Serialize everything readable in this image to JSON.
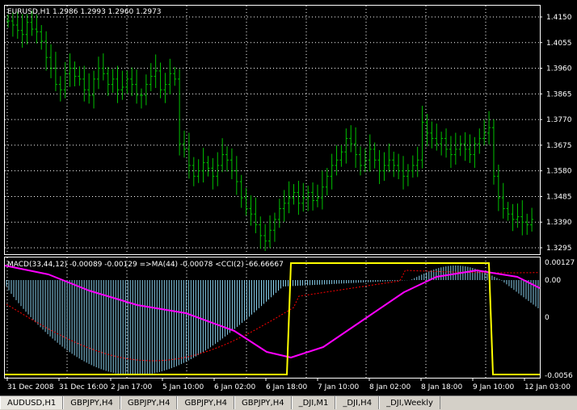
{
  "main_chart": {
    "info": "EURUSD,H1  1.2986 1.2993 1.2960 1.2973",
    "price_labels": [
      "1.4150",
      "1.4055",
      "1.3960",
      "1.3865",
      "1.3770",
      "1.3675",
      "1.3580",
      "1.3485",
      "1.3390",
      "1.3295"
    ],
    "price_values": [
      1.415,
      1.4055,
      1.396,
      1.3865,
      1.377,
      1.3675,
      1.358,
      1.3485,
      1.339,
      1.3295
    ],
    "candle_color": "#00c000",
    "closes": [
      1.4135,
      1.412,
      1.41,
      1.4085,
      1.413,
      1.4105,
      1.4095,
      1.406,
      1.4,
      1.396,
      1.39,
      1.388,
      1.394,
      1.396,
      1.393,
      1.392,
      1.388,
      1.386,
      1.392,
      1.396,
      1.394,
      1.39,
      1.392,
      1.388,
      1.389,
      1.392,
      1.39,
      1.386,
      1.386,
      1.39,
      1.393,
      1.395,
      1.388,
      1.39,
      1.394,
      1.392,
      1.368,
      1.366,
      1.36,
      1.356,
      1.358,
      1.361,
      1.359,
      1.356,
      1.36,
      1.364,
      1.362,
      1.358,
      1.354,
      1.348,
      1.344,
      1.342,
      1.338,
      1.334,
      1.332,
      1.336,
      1.34,
      1.344,
      1.346,
      1.348,
      1.35,
      1.346,
      1.348,
      1.35,
      1.347,
      1.348,
      1.352,
      1.356,
      1.36,
      1.362,
      1.365,
      1.37,
      1.368,
      1.364,
      1.36,
      1.362,
      1.366,
      1.362,
      1.358,
      1.36,
      1.362,
      1.36,
      1.358,
      1.356,
      1.358,
      1.36,
      1.362,
      1.376,
      1.372,
      1.37,
      1.368,
      1.37,
      1.366,
      1.364,
      1.366,
      1.368,
      1.366,
      1.364,
      1.368,
      1.37,
      1.372,
      1.374,
      1.356,
      1.348,
      1.344,
      1.342,
      1.34,
      1.341,
      1.339,
      1.338,
      1.34
    ]
  },
  "indicator": {
    "info": "MACD(33,44,12) -0.00089 -0.00129  =>MA(44) -0.00078  <CCI(2) -66.66667",
    "level_labels": [
      "0.00127",
      "0.00",
      "0",
      "-0.0056"
    ],
    "hist_color": "#87ceeb",
    "signal_color": "#ff0000",
    "ma_color": "#ff00ff",
    "cci_color": "#ffff00"
  },
  "time_labels": [
    "31 Dec 2008",
    "31 Dec 16:00",
    "2 Jan 17:00",
    "5 Jan 10:00",
    "6 Jan 02:00",
    "6 Jan 18:00",
    "7 Jan 10:00",
    "8 Jan 02:00",
    "8 Jan 18:00",
    "9 Jan 10:00",
    "12 Jan 03:00"
  ],
  "tabs": [
    "AUDUSD,H1",
    "GBPJPY,H4",
    "GBPJPY,H4",
    "GBPJPY,H4",
    "GBPJPY,H4",
    "_DJI,M1",
    "_DJI,H4",
    "_DJI,Weekly"
  ],
  "active_tab": 0
}
